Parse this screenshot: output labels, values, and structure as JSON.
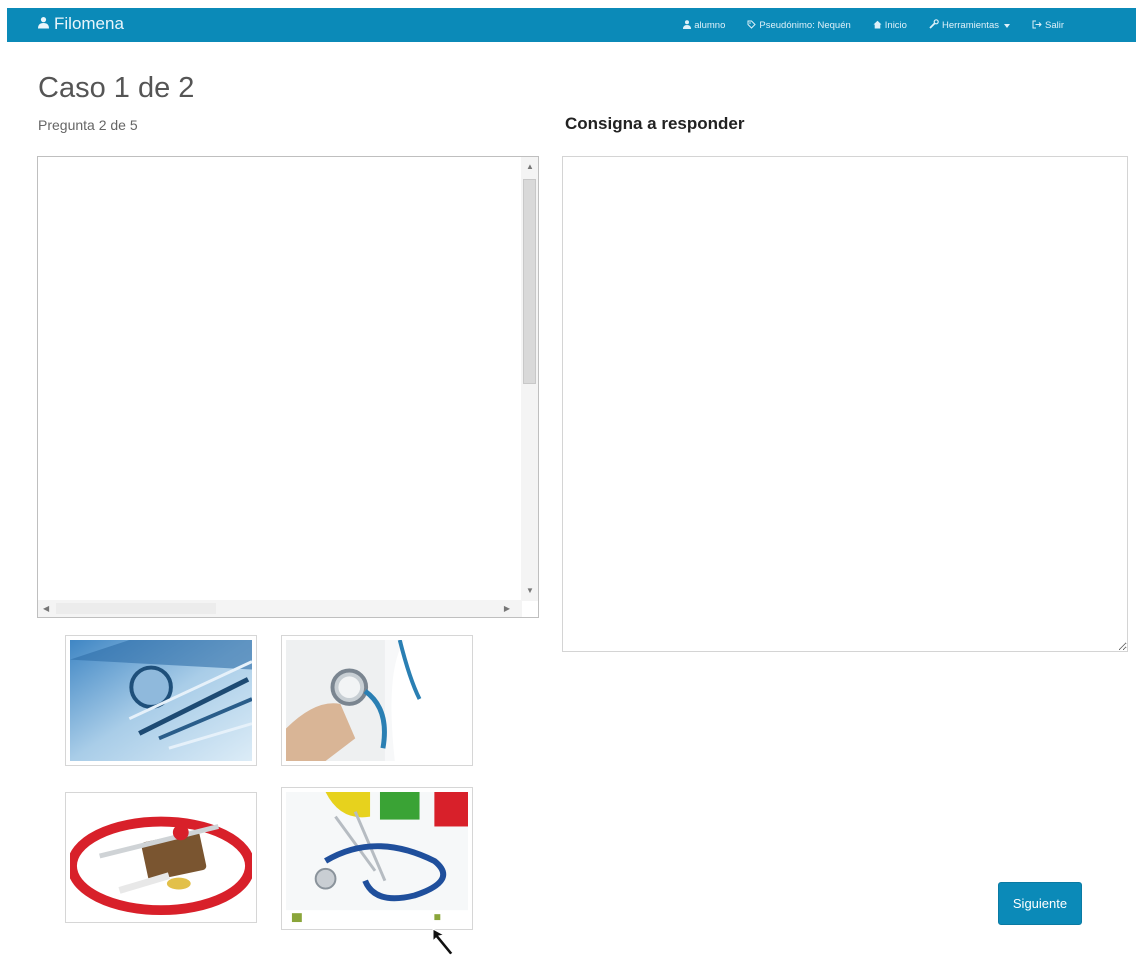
{
  "navbar": {
    "brand": "Filomena",
    "user": "alumno",
    "pseudonym": "Pseudónimo: Nequén",
    "home": "Inicio",
    "tools": "Herramientas",
    "logout": "Salir"
  },
  "case": {
    "title": "Caso 1 de 2",
    "question": "Pregunta 2 de 5"
  },
  "prompt": {
    "label": "Consigna a responder"
  },
  "answer": {
    "value": ""
  },
  "thumbnails": {
    "items": [
      {
        "icon": "dental-instruments-image"
      },
      {
        "icon": "doctor-stethoscope-image"
      },
      {
        "icon": "stethoscope-pills-image"
      },
      {
        "icon": "medical-tools-image"
      }
    ]
  },
  "actions": {
    "next_label": "Siguiente"
  },
  "colors": {
    "primary": "#0b8ab8"
  }
}
